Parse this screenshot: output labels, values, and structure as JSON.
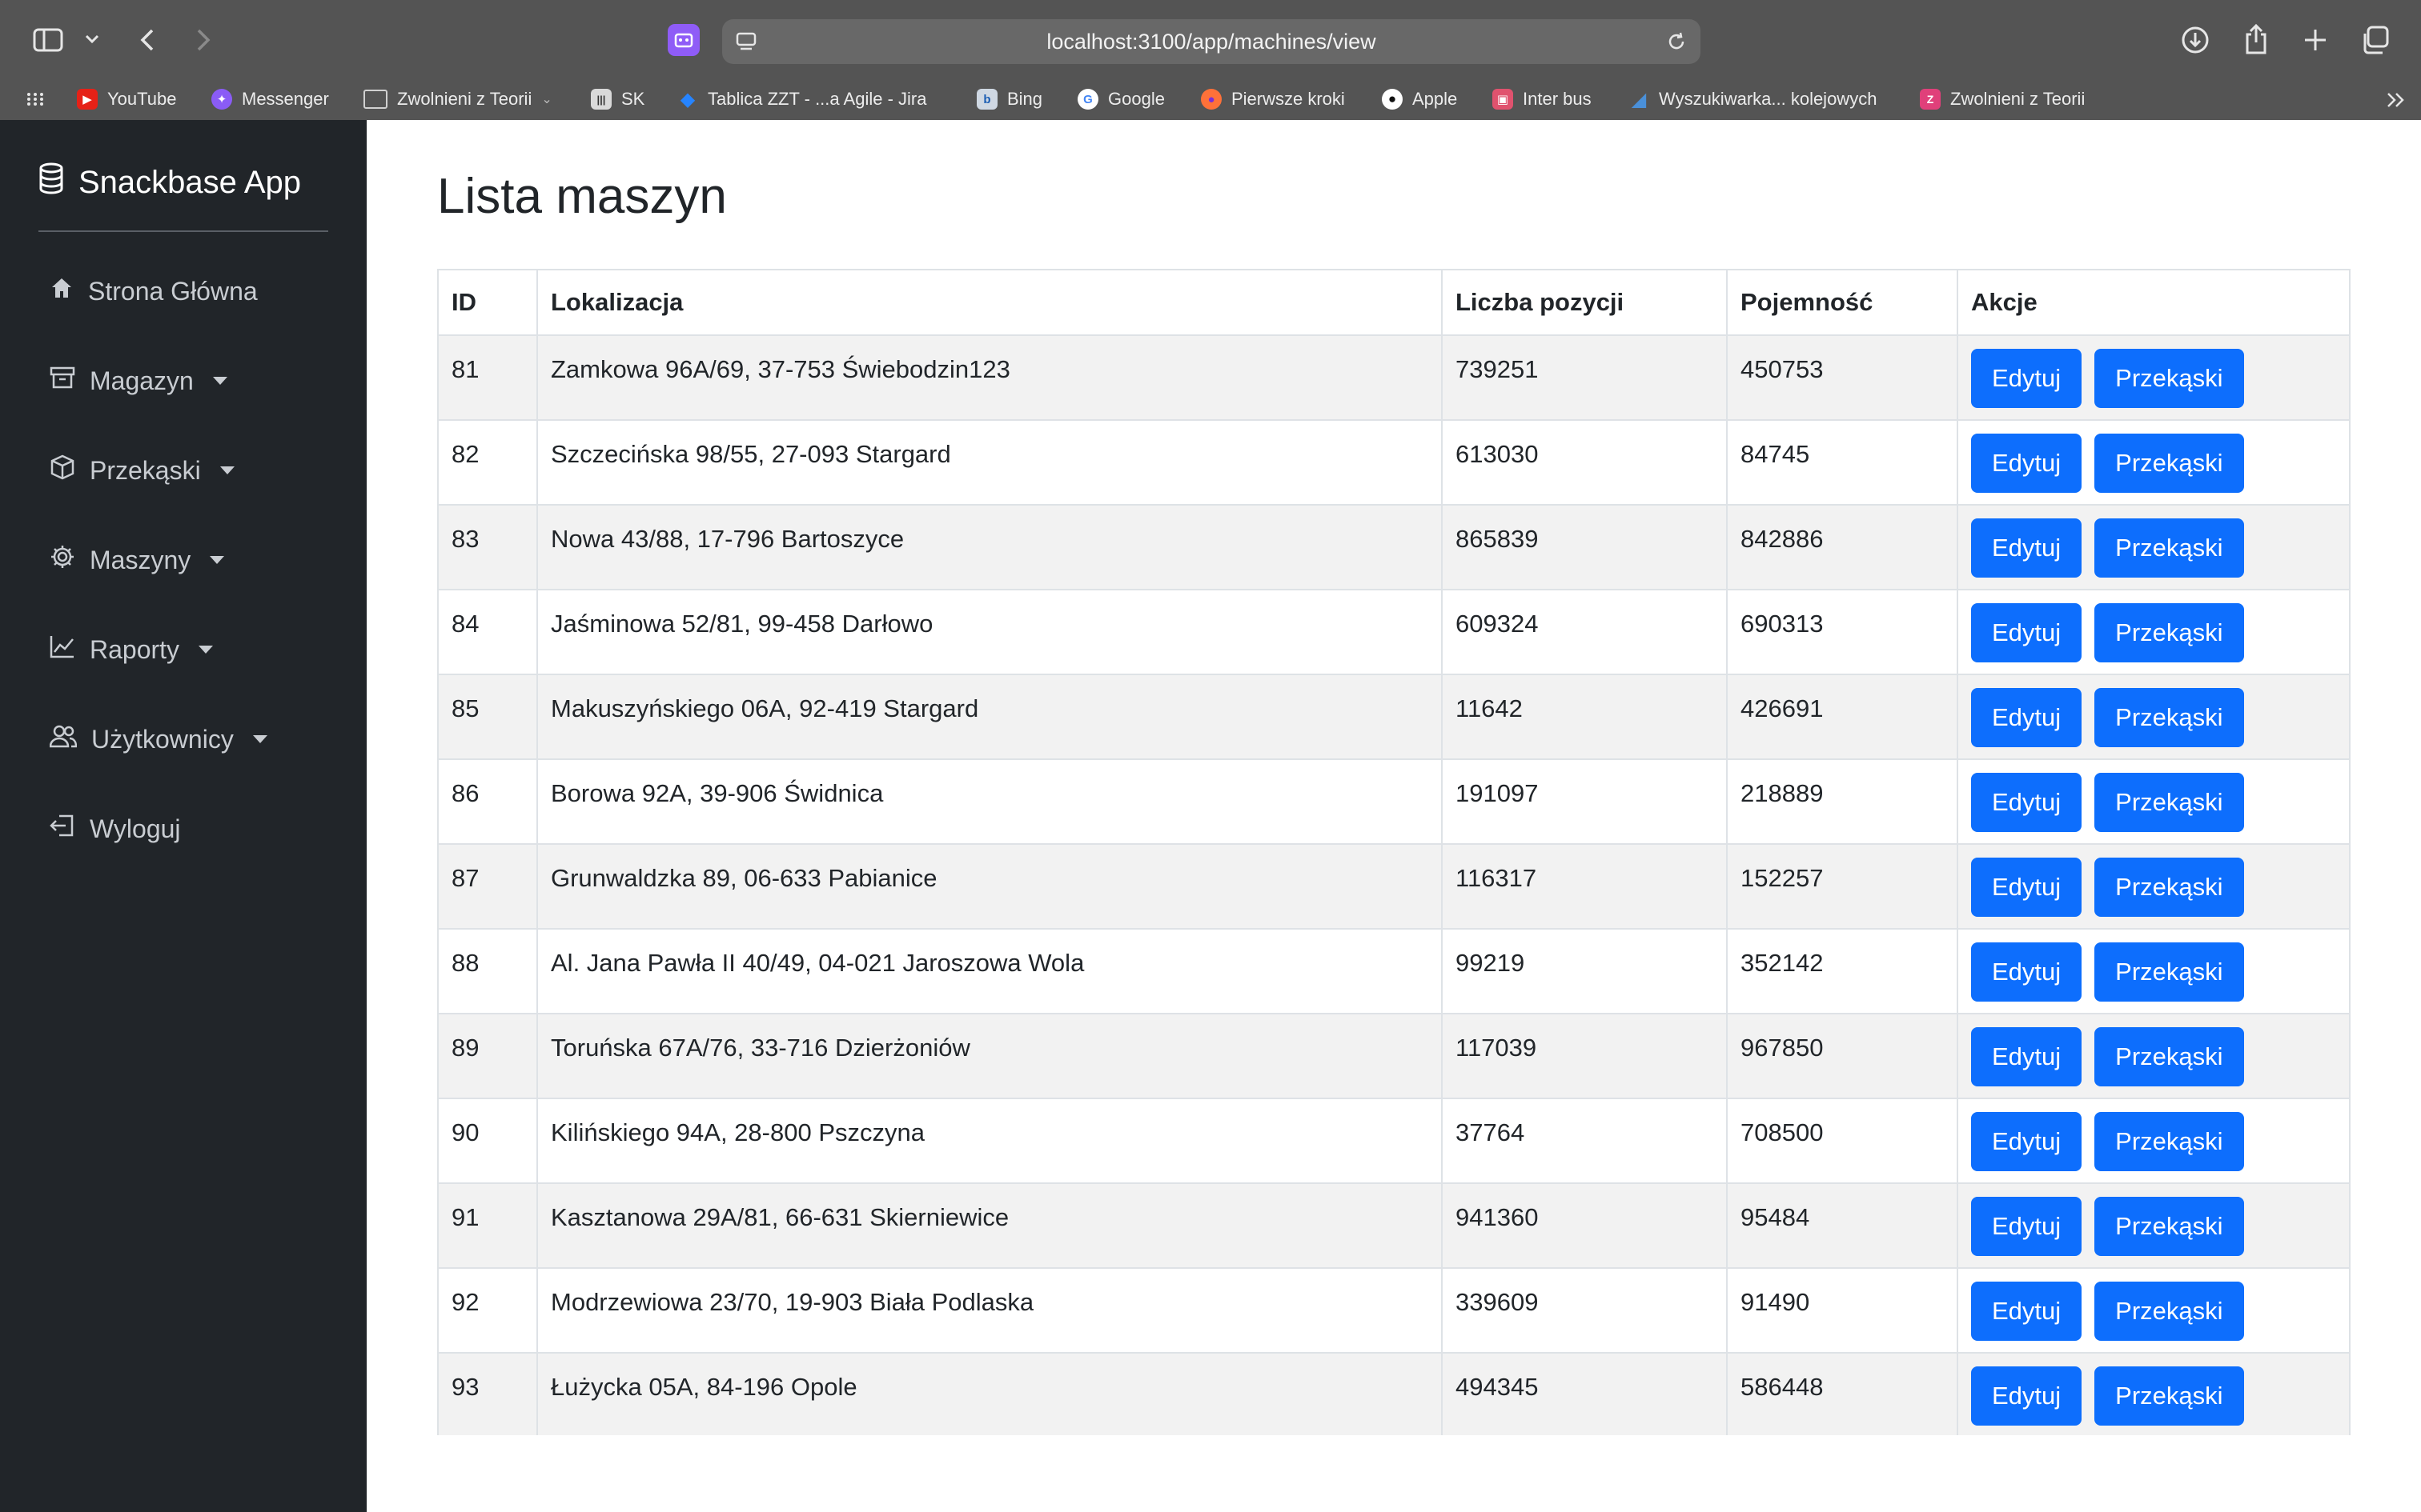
{
  "browser": {
    "url": "localhost:3100/app/machines/view",
    "bookmarks": [
      {
        "label": "YouTube",
        "icon": "youtube-icon",
        "color": "#e62117",
        "glyph": "▶"
      },
      {
        "label": "Messenger",
        "icon": "messenger-icon",
        "color": "#8a5cf6",
        "glyph": "✦"
      },
      {
        "label": "Zwolnieni z Teorii",
        "icon": "folder-icon",
        "color": "#545454",
        "glyph": "▭"
      },
      {
        "label": "SK",
        "icon": "sk-icon",
        "color": "#cfcfcf",
        "glyph": "|||"
      },
      {
        "label": "Tablica ZZT - ...a Agile - Jira",
        "icon": "jira-icon",
        "color": "#2684ff",
        "glyph": "◆"
      },
      {
        "label": "Bing",
        "icon": "bing-icon",
        "color": "#cfd8e3",
        "glyph": "b"
      },
      {
        "label": "Google",
        "icon": "google-icon",
        "color": "#ffffff",
        "glyph": "G"
      },
      {
        "label": "Pierwsze kroki",
        "icon": "firefox-icon",
        "color": "#ff7139",
        "glyph": "●"
      },
      {
        "label": "Apple",
        "icon": "apple-icon",
        "color": "#ffffff",
        "glyph": "●"
      },
      {
        "label": "Inter bus",
        "icon": "bus-icon",
        "color": "#e0526e",
        "glyph": "▣"
      },
      {
        "label": "Wyszukiwarka... kolejowych",
        "icon": "train-icon",
        "color": "#4a90d9",
        "glyph": "◢"
      },
      {
        "label": "Zwolnieni z Teorii",
        "icon": "zzt-icon",
        "color": "#e0407a",
        "glyph": "Z"
      }
    ]
  },
  "sidebar": {
    "brand": "Snackbase App",
    "items": [
      {
        "label": "Strona Główna",
        "icon": "home-icon",
        "dropdown": false
      },
      {
        "label": "Magazyn",
        "icon": "archive-icon",
        "dropdown": true
      },
      {
        "label": "Przekąski",
        "icon": "box-icon",
        "dropdown": true
      },
      {
        "label": "Maszyny",
        "icon": "gear-icon",
        "dropdown": true
      },
      {
        "label": "Raporty",
        "icon": "chart-icon",
        "dropdown": true
      },
      {
        "label": "Użytkownicy",
        "icon": "users-icon",
        "dropdown": true
      },
      {
        "label": "Wyloguj",
        "icon": "logout-icon",
        "dropdown": false
      }
    ]
  },
  "main": {
    "title": "Lista maszyn",
    "columns": [
      "ID",
      "Lokalizacja",
      "Liczba pozycji",
      "Pojemność",
      "Akcje"
    ],
    "edit_label": "Edytuj",
    "snacks_label": "Przekąski",
    "accent": "#0d6efd",
    "rows": [
      {
        "id": "81",
        "location": "Zamkowa 96A/69, 37-753 Świebodzin123",
        "positions": "739251",
        "capacity": "450753"
      },
      {
        "id": "82",
        "location": "Szczecińska 98/55, 27-093 Stargard",
        "positions": "613030",
        "capacity": "84745"
      },
      {
        "id": "83",
        "location": "Nowa 43/88, 17-796 Bartoszyce",
        "positions": "865839",
        "capacity": "842886"
      },
      {
        "id": "84",
        "location": "Jaśminowa 52/81, 99-458 Darłowo",
        "positions": "609324",
        "capacity": "690313"
      },
      {
        "id": "85",
        "location": "Makuszyńskiego 06A, 92-419 Stargard",
        "positions": "11642",
        "capacity": "426691"
      },
      {
        "id": "86",
        "location": "Borowa 92A, 39-906 Świdnica",
        "positions": "191097",
        "capacity": "218889"
      },
      {
        "id": "87",
        "location": "Grunwaldzka 89, 06-633 Pabianice",
        "positions": "116317",
        "capacity": "152257"
      },
      {
        "id": "88",
        "location": "Al. Jana Pawła II 40/49, 04-021 Jaroszowa Wola",
        "positions": "99219",
        "capacity": "352142"
      },
      {
        "id": "89",
        "location": "Toruńska 67A/76, 33-716 Dzierżoniów",
        "positions": "117039",
        "capacity": "967850"
      },
      {
        "id": "90",
        "location": "Kilińskiego 94A, 28-800 Pszczyna",
        "positions": "37764",
        "capacity": "708500"
      },
      {
        "id": "91",
        "location": "Kasztanowa 29A/81, 66-631 Skierniewice",
        "positions": "941360",
        "capacity": "95484"
      },
      {
        "id": "92",
        "location": "Modrzewiowa 23/70, 19-903 Biała Podlaska",
        "positions": "339609",
        "capacity": "91490"
      },
      {
        "id": "93",
        "location": "Łużycka 05A, 84-196 Opole",
        "positions": "494345",
        "capacity": "586448"
      }
    ]
  }
}
